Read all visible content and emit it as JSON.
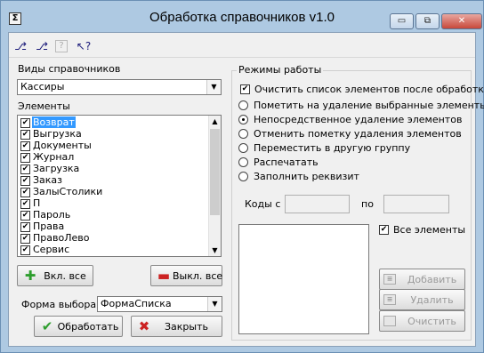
{
  "window": {
    "title": "Обработка справочников v1.0",
    "icon_glyph": "Σ",
    "buttons": {
      "minimize": "▭",
      "maximize": "⧉",
      "close": "✕"
    }
  },
  "toolbar": {
    "items": [
      {
        "name": "toolbar-tool-1-icon",
        "glyph": "⎇",
        "enabled": true
      },
      {
        "name": "toolbar-tool-2-icon",
        "glyph": "⎇",
        "enabled": true
      },
      {
        "name": "toolbar-help-icon",
        "glyph": "?",
        "enabled": false
      },
      {
        "name": "toolbar-context-help-icon",
        "glyph": "↖?",
        "enabled": true
      }
    ]
  },
  "left": {
    "catalog_types_label": "Виды справочников",
    "catalog_type_value": "Кассиры",
    "elements_label": "Элементы",
    "elements": [
      {
        "label": "Возврат",
        "checked": true,
        "selected": true
      },
      {
        "label": "Выгрузка",
        "checked": true,
        "selected": false
      },
      {
        "label": "Документы",
        "checked": true,
        "selected": false
      },
      {
        "label": "Журнал",
        "checked": true,
        "selected": false
      },
      {
        "label": "Загрузка",
        "checked": true,
        "selected": false
      },
      {
        "label": "Заказ",
        "checked": true,
        "selected": false
      },
      {
        "label": "ЗалыСтолики",
        "checked": true,
        "selected": false
      },
      {
        "label": "П",
        "checked": true,
        "selected": false
      },
      {
        "label": "Пароль",
        "checked": true,
        "selected": false
      },
      {
        "label": "Права",
        "checked": true,
        "selected": false
      },
      {
        "label": "ПравоЛево",
        "checked": true,
        "selected": false
      },
      {
        "label": "Сервис",
        "checked": true,
        "selected": false
      }
    ],
    "check_all_label": "Вкл. все",
    "uncheck_all_label": "Выкл. все",
    "form_label": "Форма выбора",
    "form_value": "ФормаСписка",
    "process_label": "Обработать",
    "close_label": "Закрыть"
  },
  "right": {
    "group_title": "Режимы работы",
    "clear_after_label": "Очистить список элементов после обработки",
    "clear_after_checked": true,
    "modes": [
      {
        "label": "Пометить на удаление выбранные элементы",
        "selected": false
      },
      {
        "label": "Непосредственное удаление элементов",
        "selected": true
      },
      {
        "label": "Отменить пометку удаления элементов",
        "selected": false
      },
      {
        "label": "Переместить в другую группу",
        "selected": false
      },
      {
        "label": "Распечатать",
        "selected": false
      },
      {
        "label": "Заполнить реквизит",
        "selected": false
      }
    ],
    "codes_from_label": "Коды с",
    "codes_to_label": "по",
    "codes_from_value": "",
    "codes_to_value": "",
    "all_elements_label": "Все элементы",
    "all_elements_checked": true,
    "add_label": "Добавить",
    "remove_label": "Удалить",
    "clear_label": "Очистить"
  },
  "colors": {
    "accent": "#3399ff",
    "titlebar": "#aec9e2",
    "close": "#c8483a",
    "check_green": "#2e9e2e",
    "minus_red": "#cc2222"
  }
}
